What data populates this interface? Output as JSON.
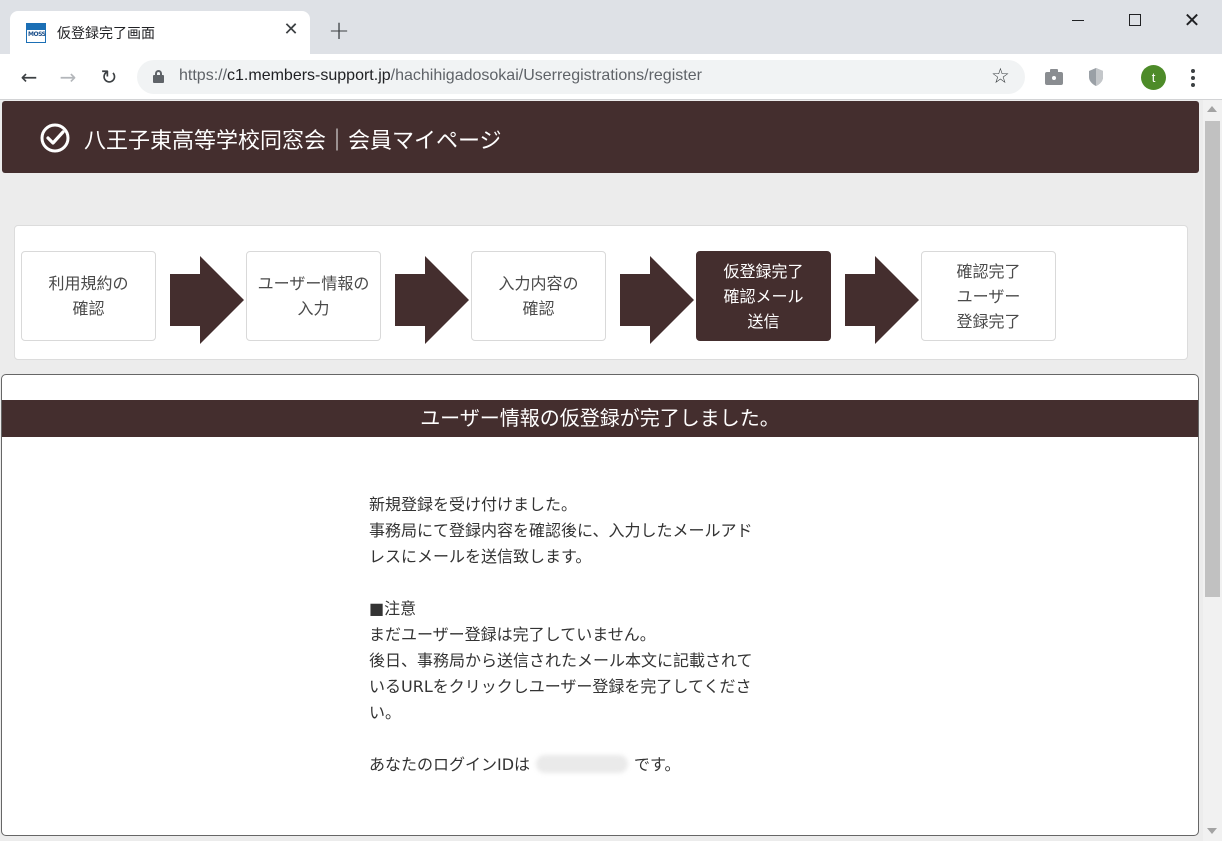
{
  "browser": {
    "tab_title": "仮登録完了画面",
    "tab_favicon_text": "MOSS",
    "tab_close_glyph": "✕",
    "new_tab_glyph": "+",
    "url_prefix": "https://",
    "url_host": "c1.members-support.jp",
    "url_path": "/hachihigadosokai/Userregistrations/register",
    "nav_back_glyph": "←",
    "nav_forward_glyph": "→",
    "nav_reload_glyph": "↻",
    "star_glyph": "☆",
    "close_glyph": "✕",
    "profile_initial": "t"
  },
  "site": {
    "title": "八王子東高等学校同窓会｜会員マイページ"
  },
  "steps": [
    {
      "label": "利用規約の\n確認",
      "active": false
    },
    {
      "label": "ユーザー情報の\n入力",
      "active": false
    },
    {
      "label": "入力内容の\n確認",
      "active": false
    },
    {
      "label": "仮登録完了\n確認メール\n送信",
      "active": true
    },
    {
      "label": "確認完了\nユーザー\n登録完了",
      "active": false
    }
  ],
  "content": {
    "heading": "ユーザー情報の仮登録が完了しました。",
    "line1": "新規登録を受け付けました。",
    "line2": "事務局にて登録内容を確認後に、入力したメールアド",
    "line3": "レスにメールを送信致します。",
    "notice_heading": "■注意",
    "line4": "まだユーザー登録は完了していません。",
    "line5": "後日、事務局から送信されたメール本文に記載されて",
    "line6": "いるURLをクリックしユーザー登録を完了してくださ",
    "line7": "い。",
    "login_prefix": "あなたのログインIDは",
    "login_suffix": "です。"
  },
  "colors": {
    "brand": "#442e2e",
    "chrome": "#dee1e6",
    "page_bg": "#ececec",
    "avatar": "#4d8b29"
  }
}
